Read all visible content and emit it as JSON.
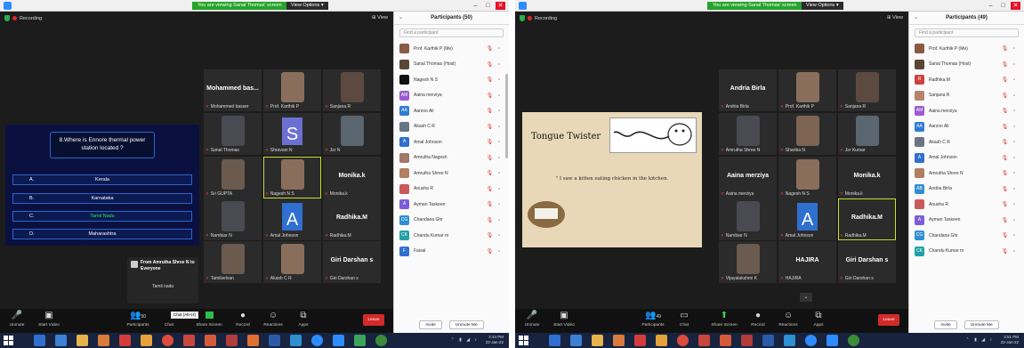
{
  "left": {
    "banner": "You are viewing Sanal Thomas' screen",
    "view_options": "View Options ▾",
    "recording": "Recording",
    "view": "View",
    "participants_title": "Participants (50)",
    "search_placeholder": "Find a participant",
    "quiz": {
      "question": "8.Where is Ennore thermal power station located ?",
      "options": [
        {
          "letter": "A.",
          "text": "Kerala"
        },
        {
          "letter": "B.",
          "text": "Karnataka"
        },
        {
          "letter": "C.",
          "text": "Tamil Nadu"
        },
        {
          "letter": "D.",
          "text": "Maharashtra"
        }
      ]
    },
    "chat": {
      "from": "From Amrutha Shree N to Everyone",
      "message": "Tamil nadu",
      "tip": "Chat (Alt+H)"
    },
    "tiles": [
      {
        "big": "Mohammed bas...",
        "label": "Mohammed basser"
      },
      {
        "big": "",
        "label": "Prof. Karthik P"
      },
      {
        "big": "",
        "label": "Sanjana R"
      },
      {
        "big": "",
        "label": "Sanal Thomas"
      },
      {
        "big": "S",
        "label": "Shravani N"
      },
      {
        "big": "",
        "label": "Jsr N"
      },
      {
        "big": "",
        "label": "Sri GUPTA"
      },
      {
        "big": "",
        "label": "Nagesh N S"
      },
      {
        "big": "Monika.k",
        "label": "Monika.k"
      },
      {
        "big": "",
        "label": "Nambiar N"
      },
      {
        "big": "A",
        "label": "Amal Johnson"
      },
      {
        "big": "Radhika.M",
        "label": "Radhika.M"
      },
      {
        "big": "",
        "label": "Tamilselvan"
      },
      {
        "big": "",
        "label": "Akash C R"
      },
      {
        "big": "Giri Darshan s",
        "label": "Giri Darshan s"
      }
    ],
    "participants": [
      {
        "name": "Prof. Karthik P (Me)",
        "initials": "",
        "color": "#8a5a44"
      },
      {
        "name": "Sanal Thomas (Host)",
        "initials": "",
        "color": "#5a4636"
      },
      {
        "name": "Nagesh N S",
        "initials": "",
        "color": "#111111"
      },
      {
        "name": "Aaina merziya",
        "initials": "AM",
        "color": "#9a5bd0"
      },
      {
        "name": "Aarzoo Ali",
        "initials": "AA",
        "color": "#2f7dd1"
      },
      {
        "name": "Akash C R",
        "initials": "",
        "color": "#6a7484"
      },
      {
        "name": "Amal Johnson",
        "initials": "A",
        "color": "#2f6fd0"
      },
      {
        "name": "Amrutha Nagesh",
        "initials": "",
        "color": "#a2786a"
      },
      {
        "name": "Amrutha Shree N",
        "initials": "",
        "color": "#b27f62"
      },
      {
        "name": "Anusha R",
        "initials": "",
        "color": "#c85a5a"
      },
      {
        "name": "Ayman Taskeen",
        "initials": "A",
        "color": "#7c5cd8"
      },
      {
        "name": "Chandana Ghr",
        "initials": "CG",
        "color": "#2f8fd0"
      },
      {
        "name": "Chandu Kumar m",
        "initials": "CK",
        "color": "#23a0a8"
      },
      {
        "name": "Faisal",
        "initials": "F",
        "color": "#2f6fd0"
      }
    ],
    "invite": "Invite",
    "unmute_me": "Unmute Me",
    "controls": [
      "Unmute",
      "Start Video",
      "Participants",
      "Chat",
      "Share Screen",
      "Record",
      "Reactions",
      "Apps"
    ],
    "participant_count": "50",
    "leave": "Leave",
    "clock": "2:44 PM",
    "date": "22-Jan-22"
  },
  "right": {
    "banner": "You are viewing Sanal Thomas' screen",
    "view_options": "View Options ▾",
    "recording": "Recording",
    "view": "View",
    "participants_title": "Participants (49)",
    "search_placeholder": "Find a participant",
    "slide": {
      "title": "Tongue Twister",
      "text": "\" I saw a kitten eating chicken in the kitchen."
    },
    "tiles": [
      {
        "big": "Andria Birla",
        "label": "Andria Birla"
      },
      {
        "big": "",
        "label": "Prof. Karthik P"
      },
      {
        "big": "",
        "label": "Sanjana R"
      },
      {
        "big": "",
        "label": "Amrutha Shree N"
      },
      {
        "big": "",
        "label": "Shariba N"
      },
      {
        "big": "",
        "label": "Jsr Kumar"
      },
      {
        "big": "Aaina merziya",
        "label": "Aaina merziya"
      },
      {
        "big": "",
        "label": "Nagesh N S"
      },
      {
        "big": "Monika.k",
        "label": "Monika.k"
      },
      {
        "big": "",
        "label": "Nambiar N"
      },
      {
        "big": "A",
        "label": "Amal Johnson"
      },
      {
        "big": "Radhika.M",
        "label": "Radhika.M"
      },
      {
        "big": "",
        "label": "Vijayalakshmi K"
      },
      {
        "big": "HAJIRA",
        "label": "HAJIRA"
      },
      {
        "big": "Giri Darshan s",
        "label": "Giri Darshan s"
      }
    ],
    "participants": [
      {
        "name": "Prof. Karthik P (Me)",
        "initials": "",
        "color": "#8a5a44"
      },
      {
        "name": "Sanal Thomas (Host)",
        "initials": "",
        "color": "#5a4636"
      },
      {
        "name": "Radhika.M",
        "initials": "R",
        "color": "#d04040"
      },
      {
        "name": "Sanjana R",
        "initials": "",
        "color": "#b7836c"
      },
      {
        "name": "Aaina merziya",
        "initials": "AM",
        "color": "#9a5bd0"
      },
      {
        "name": "Aarzoo Ali",
        "initials": "AA",
        "color": "#2f7dd1"
      },
      {
        "name": "Akash C R",
        "initials": "",
        "color": "#6a7484"
      },
      {
        "name": "Amal Johnson",
        "initials": "A",
        "color": "#2f6fd0"
      },
      {
        "name": "Amrutha Shree N",
        "initials": "",
        "color": "#b27f62"
      },
      {
        "name": "Andria Birla",
        "initials": "AB",
        "color": "#2f8fd0"
      },
      {
        "name": "Anusha R",
        "initials": "",
        "color": "#c85a5a"
      },
      {
        "name": "Ayman Taskeen",
        "initials": "A",
        "color": "#7c5cd8"
      },
      {
        "name": "Chandana Ghr",
        "initials": "CG",
        "color": "#2f8fd0"
      },
      {
        "name": "Chandu Kumar m",
        "initials": "CK",
        "color": "#23a0a8"
      }
    ],
    "invite": "Invite",
    "unmute_me": "Unmute Me",
    "controls": [
      "Unmute",
      "Start Video",
      "Participants",
      "Chat",
      "Share Screen",
      "Record",
      "Reactions",
      "Apps"
    ],
    "participant_count": "49",
    "leave": "Leave",
    "clock": "2:51 PM",
    "date": "22-Jan-22"
  },
  "colors": {
    "accent_green": "#26a32b",
    "leave_red": "#d42a2a",
    "selected_outline": "#c8e030",
    "quiz_bg": "#0a1140"
  }
}
